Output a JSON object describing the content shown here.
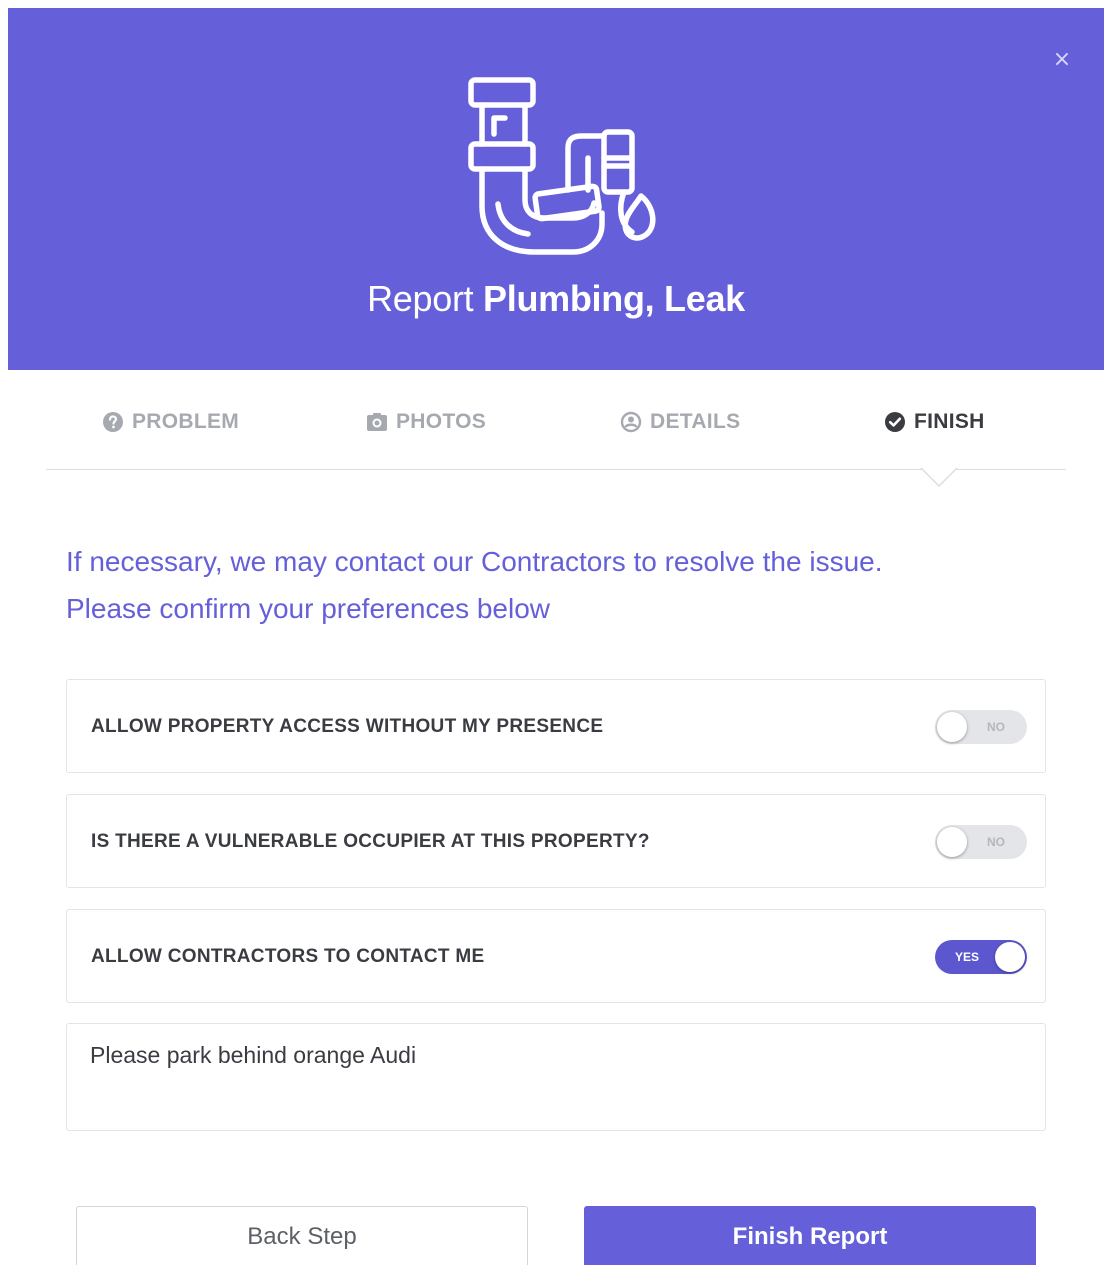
{
  "header": {
    "title_prefix": "Report",
    "title_bold": "Plumbing, Leak",
    "close_label": "×",
    "icon": "plumbing-leak-icon",
    "background_color": "#6560da"
  },
  "tabs": [
    {
      "label": "PROBLEM",
      "icon": "question-circle-icon",
      "active": false
    },
    {
      "label": "PHOTOS",
      "icon": "camera-icon",
      "active": false
    },
    {
      "label": "DETAILS",
      "icon": "user-circle-icon",
      "active": false
    },
    {
      "label": "FINISH",
      "icon": "check-circle-icon",
      "active": true
    }
  ],
  "intro": {
    "line1": "If necessary, we may contact our Contractors to resolve the issue.",
    "line2": "Please confirm your preferences below"
  },
  "options": [
    {
      "label": "ALLOW PROPERTY ACCESS WITHOUT MY PRESENCE",
      "state": "NO",
      "on": false
    },
    {
      "label": "IS THERE A VULNERABLE OCCUPIER AT THIS PROPERTY?",
      "state": "NO",
      "on": false
    },
    {
      "label": "ALLOW CONTRACTORS TO CONTACT ME",
      "state": "YES",
      "on": true
    }
  ],
  "notes": {
    "value": "Please park behind orange Audi"
  },
  "buttons": {
    "back_label": "Back Step",
    "finish_label": "Finish Report"
  },
  "colors": {
    "accent": "#6560da",
    "text_dark": "#3a3c42",
    "text_muted": "#a7a9b1"
  }
}
